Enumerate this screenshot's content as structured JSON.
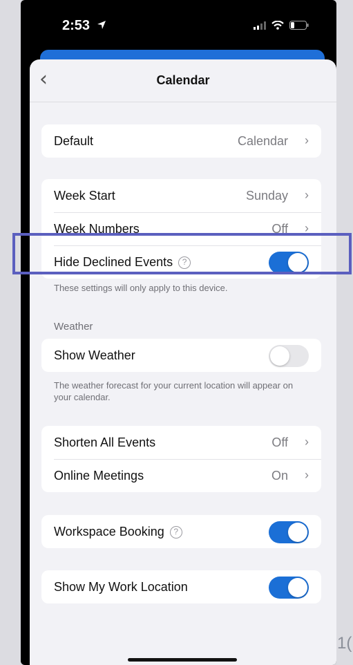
{
  "status": {
    "time": "2:53",
    "location_icon": "location-arrow-icon",
    "signal_icon": "signal-icon",
    "wifi_icon": "wifi-icon",
    "battery_icon": "battery-icon"
  },
  "nav": {
    "title": "Calendar",
    "back_icon": "back-chevron-icon"
  },
  "default_row": {
    "label": "Default",
    "value": "Calendar"
  },
  "week_start": {
    "label": "Week Start",
    "value": "Sunday"
  },
  "week_numbers": {
    "label": "Week Numbers",
    "value": "Off"
  },
  "hide_declined": {
    "label": "Hide Declined Events",
    "on": true
  },
  "device_note": "These settings will only apply to this device.",
  "weather": {
    "header": "Weather",
    "label": "Show Weather",
    "on": false,
    "caption": "The weather forecast for your current location will appear on your calendar."
  },
  "shorten_all": {
    "label": "Shorten All Events",
    "value": "Off"
  },
  "online_meetings": {
    "label": "Online Meetings",
    "value": "On"
  },
  "workspace_booking": {
    "label": "Workspace Booking",
    "on": true
  },
  "work_location": {
    "label": "Show My Work Location",
    "on": true
  },
  "corner_text": "1(",
  "colors": {
    "accent": "#1b6fd6",
    "highlight": "#5b5fbf",
    "background": "#f2f2f6"
  }
}
